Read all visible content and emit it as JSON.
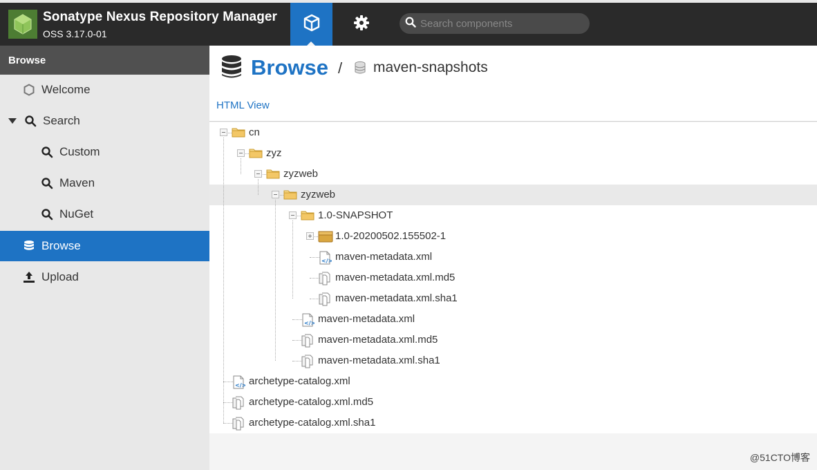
{
  "app": {
    "title": "Sonatype Nexus Repository Manager",
    "version": "OSS 3.17.0-01"
  },
  "header": {
    "search_placeholder": "Search components"
  },
  "sidebar": {
    "header": "Browse",
    "items": [
      {
        "label": "Welcome",
        "icon": "hexagon-icon"
      },
      {
        "label": "Search",
        "icon": "search-icon"
      },
      {
        "label": "Custom",
        "icon": "search-icon"
      },
      {
        "label": "Maven",
        "icon": "search-icon"
      },
      {
        "label": "NuGet",
        "icon": "search-icon"
      },
      {
        "label": "Browse",
        "icon": "database-icon"
      },
      {
        "label": "Upload",
        "icon": "upload-icon"
      }
    ],
    "active": "Browse"
  },
  "main": {
    "title": "Browse",
    "breadcrumb_sep": "/",
    "repository": "maven-snapshots",
    "html_view": "HTML View"
  },
  "tree": [
    {
      "label": "cn",
      "type": "folder"
    },
    {
      "label": "zyz",
      "type": "folder"
    },
    {
      "label": "zyzweb",
      "type": "folder"
    },
    {
      "label": "zyzweb",
      "type": "folder",
      "selected": true
    },
    {
      "label": "1.0-SNAPSHOT",
      "type": "folder"
    },
    {
      "label": "1.0-20200502.155502-1",
      "type": "component"
    },
    {
      "label": "maven-metadata.xml",
      "type": "xml"
    },
    {
      "label": "maven-metadata.xml.md5",
      "type": "file"
    },
    {
      "label": "maven-metadata.xml.sha1",
      "type": "file"
    },
    {
      "label": "maven-metadata.xml",
      "type": "xml"
    },
    {
      "label": "maven-metadata.xml.md5",
      "type": "file"
    },
    {
      "label": "maven-metadata.xml.sha1",
      "type": "file"
    },
    {
      "label": "archetype-catalog.xml",
      "type": "xml"
    },
    {
      "label": "archetype-catalog.xml.md5",
      "type": "file"
    },
    {
      "label": "archetype-catalog.xml.sha1",
      "type": "file"
    }
  ],
  "watermark": "@51CTO博客",
  "colors": {
    "accent": "#1e73c4",
    "header_bg": "#2a2a2a",
    "sidebar_bg": "#e8e8e8",
    "folder": "#f3c766"
  }
}
